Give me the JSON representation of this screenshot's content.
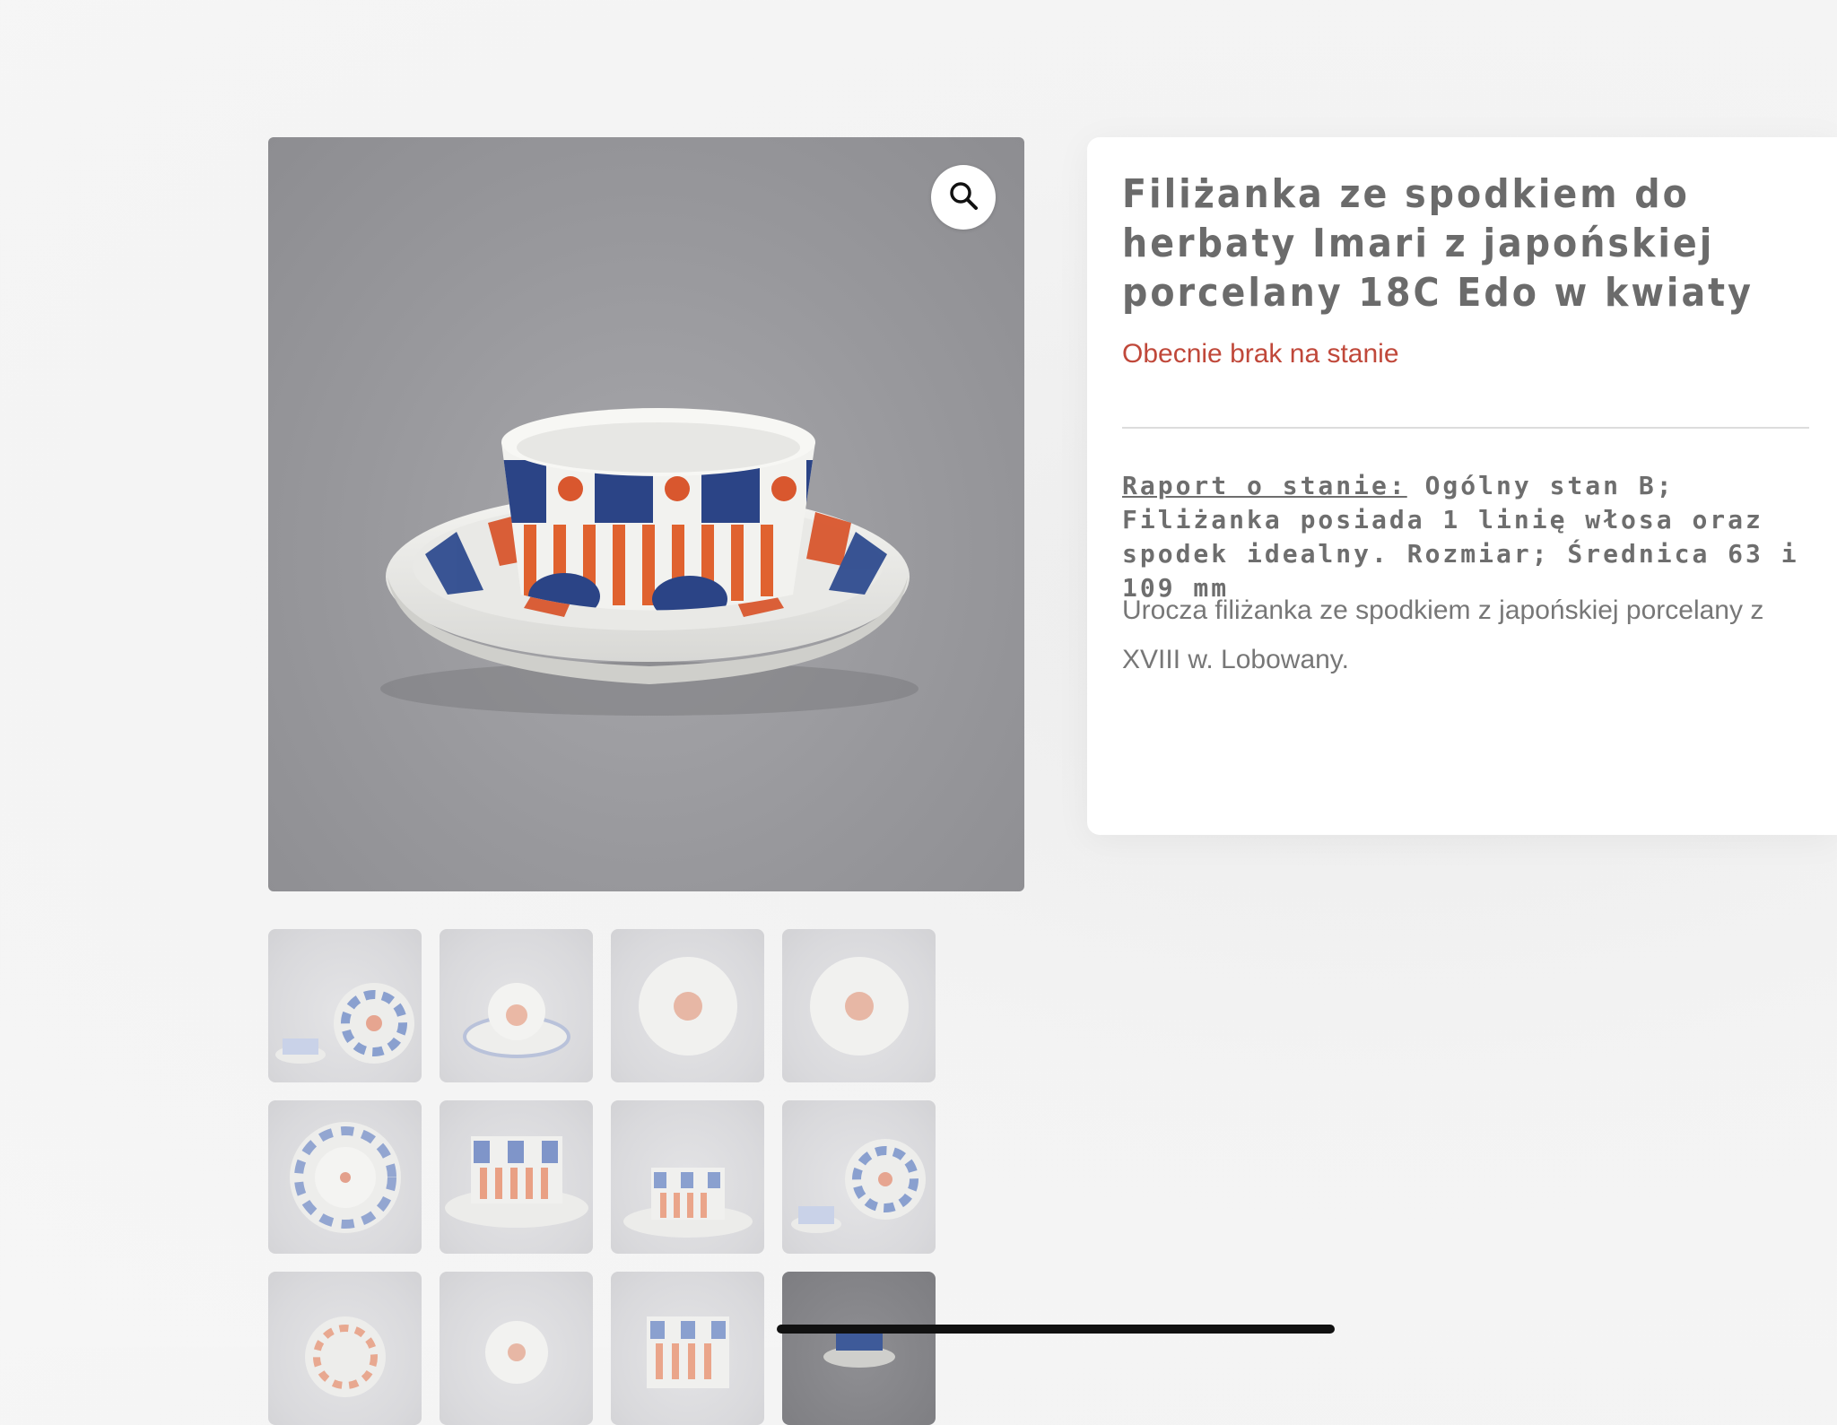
{
  "product": {
    "title": "Filiżanka ze spodkiem do herbaty Imari z japońskiej porcelany 18C Edo w kwiaty",
    "stock_status": "Obecnie brak na stanie",
    "report_label": "Raport o stanie:",
    "report_text": " Ogólny stan B; Filiżanka posiada 1 linię włosa oraz spodek idealny. Rozmiar; Średnica 63 i 109 mm",
    "description": "Urocza filiżanka ze spodkiem z japońskiej porcelany z XVIII w. Lobowany."
  },
  "icons": {
    "zoom": "magnifier-icon"
  },
  "colors": {
    "stock_status": "#c0483a",
    "imari_blue": "#2f4c8f",
    "imari_red": "#d9572e"
  },
  "gallery": {
    "thumbnails": [
      {
        "view": "set-side-by-side"
      },
      {
        "view": "cup-on-saucer-top"
      },
      {
        "view": "cup-interior"
      },
      {
        "view": "cup-interior-2"
      },
      {
        "view": "saucer-underside"
      },
      {
        "view": "cup-side-closeup"
      },
      {
        "view": "cup-on-saucer-side"
      },
      {
        "view": "set-side-by-side-2"
      },
      {
        "view": "saucer-partial"
      },
      {
        "view": "cup-partial"
      },
      {
        "view": "cup-side-partial"
      },
      {
        "view": "selected-partial",
        "selected": true
      }
    ]
  }
}
